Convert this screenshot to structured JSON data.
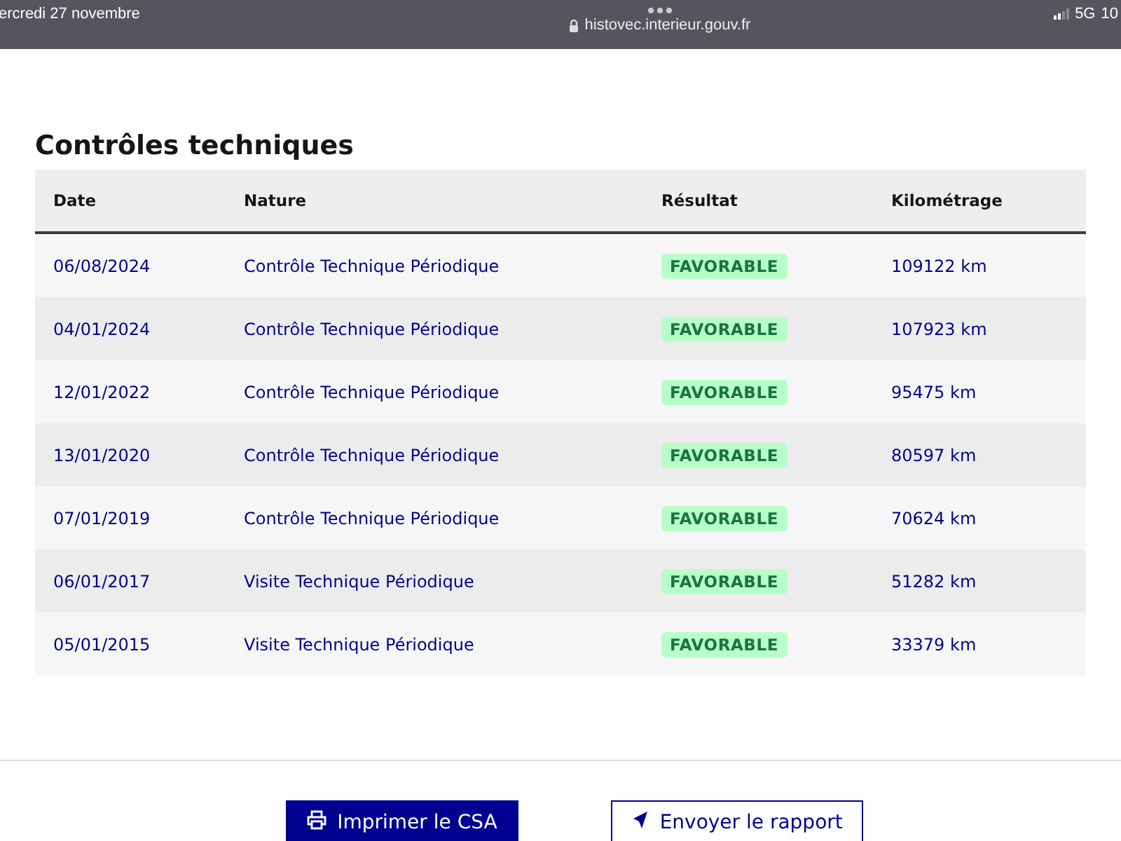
{
  "status_bar": {
    "date": "ercredi 27 novembre",
    "url": "histovec.interieur.gouv.fr",
    "network": "5G",
    "battery": "10"
  },
  "section": {
    "title": "Contrôles techniques",
    "table": {
      "columns": [
        "Date",
        "Nature",
        "Résultat",
        "Kilométrage"
      ],
      "rows": [
        {
          "date": "06/08/2024",
          "nature": "Contrôle Technique Périodique",
          "result": "FAVORABLE",
          "km": "109122 km"
        },
        {
          "date": "04/01/2024",
          "nature": "Contrôle Technique Périodique",
          "result": "FAVORABLE",
          "km": "107923 km"
        },
        {
          "date": "12/01/2022",
          "nature": "Contrôle Technique Périodique",
          "result": "FAVORABLE",
          "km": "95475 km"
        },
        {
          "date": "13/01/2020",
          "nature": "Contrôle Technique Périodique",
          "result": "FAVORABLE",
          "km": "80597 km"
        },
        {
          "date": "07/01/2019",
          "nature": "Contrôle Technique Périodique",
          "result": "FAVORABLE",
          "km": "70624 km"
        },
        {
          "date": "06/01/2017",
          "nature": "Visite Technique Périodique",
          "result": "FAVORABLE",
          "km": "51282 km"
        },
        {
          "date": "05/01/2015",
          "nature": "Visite Technique Périodique",
          "result": "FAVORABLE",
          "km": "33379 km"
        }
      ]
    }
  },
  "buttons": [
    {
      "kind": "primary",
      "label": "Imprimer le CSA"
    },
    {
      "kind": "secondary",
      "label": "Envoyer le rapport"
    }
  ]
}
